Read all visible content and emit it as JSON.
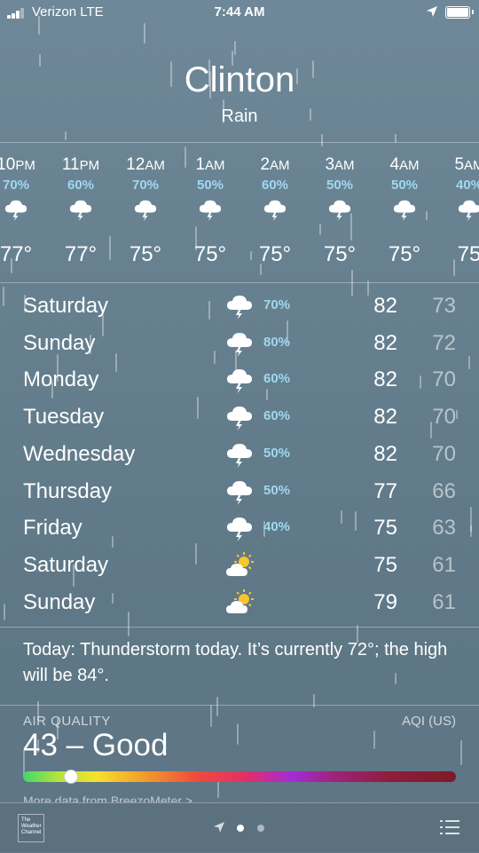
{
  "status_bar": {
    "carrier": "Verizon  LTE",
    "time": "7:44 AM"
  },
  "location": {
    "city": "Clinton",
    "condition": "Rain"
  },
  "hourly": [
    {
      "hour": "10",
      "ampm": "PM",
      "prob": "70%",
      "temp": "77°",
      "icon": "thunderstorm-icon"
    },
    {
      "hour": "11",
      "ampm": "PM",
      "prob": "60%",
      "temp": "77°",
      "icon": "thunderstorm-icon"
    },
    {
      "hour": "12",
      "ampm": "AM",
      "prob": "70%",
      "temp": "75°",
      "icon": "thunderstorm-icon"
    },
    {
      "hour": "1",
      "ampm": "AM",
      "prob": "50%",
      "temp": "75°",
      "icon": "thunderstorm-icon"
    },
    {
      "hour": "2",
      "ampm": "AM",
      "prob": "60%",
      "temp": "75°",
      "icon": "thunderstorm-icon"
    },
    {
      "hour": "3",
      "ampm": "AM",
      "prob": "50%",
      "temp": "75°",
      "icon": "thunderstorm-icon"
    },
    {
      "hour": "4",
      "ampm": "AM",
      "prob": "50%",
      "temp": "75°",
      "icon": "thunderstorm-icon"
    },
    {
      "hour": "5",
      "ampm": "AM",
      "prob": "40%",
      "temp": "75",
      "icon": "thunderstorm-icon"
    }
  ],
  "daily": [
    {
      "day": "Saturday",
      "prob": "70%",
      "high": "82",
      "low": "73",
      "icon": "thunderstorm-icon"
    },
    {
      "day": "Sunday",
      "prob": "80%",
      "high": "82",
      "low": "72",
      "icon": "thunderstorm-icon"
    },
    {
      "day": "Monday",
      "prob": "60%",
      "high": "82",
      "low": "70",
      "icon": "thunderstorm-icon"
    },
    {
      "day": "Tuesday",
      "prob": "60%",
      "high": "82",
      "low": "70",
      "icon": "thunderstorm-icon"
    },
    {
      "day": "Wednesday",
      "prob": "50%",
      "high": "82",
      "low": "70",
      "icon": "thunderstorm-icon"
    },
    {
      "day": "Thursday",
      "prob": "50%",
      "high": "77",
      "low": "66",
      "icon": "thunderstorm-icon"
    },
    {
      "day": "Friday",
      "prob": "40%",
      "high": "75",
      "low": "63",
      "icon": "thunderstorm-icon"
    },
    {
      "day": "Saturday",
      "prob": "",
      "high": "75",
      "low": "61",
      "icon": "partly-sunny-icon"
    },
    {
      "day": "Sunday",
      "prob": "",
      "high": "79",
      "low": "61",
      "icon": "partly-sunny-icon"
    }
  ],
  "summary": "Today: Thunderstorm today. It’s currently 72°; the high will be 84°.",
  "air_quality": {
    "label": "AIR QUALITY",
    "unit": "AQI (US)",
    "value": "43 – Good",
    "level_fraction": 0.11,
    "more_link": "More data from BreezoMeter >"
  },
  "tab_bar": {
    "logo_text": "The Weather Channel",
    "page_count": 2,
    "active_page": 1
  },
  "colors": {
    "probability": "#9fd8f0",
    "sun": "#f7c531"
  }
}
